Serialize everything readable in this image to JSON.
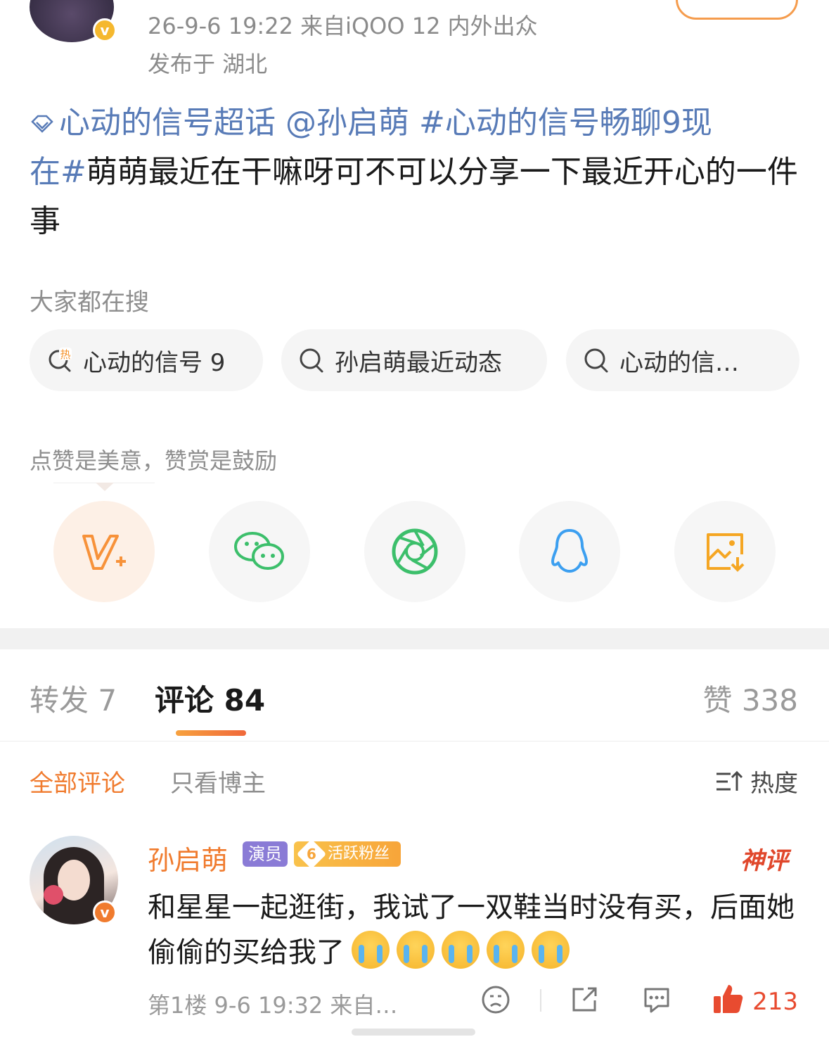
{
  "post_header": {
    "meta_line1": "26-9-6 19:22  来自iQOO 12 内外出众",
    "meta_line2": "发布于 湖北",
    "verify_mark": "v"
  },
  "post": {
    "supertopic": "心动的信号超话",
    "mention": "@孙启萌",
    "hashtag_part1": "#心动的信号畅聊9现",
    "hashtag_part2": "在#",
    "body": "萌萌最近在干嘛呀可不可以分享一下最近开心的一件事"
  },
  "hot_search": {
    "label": "大家都在搜",
    "items": [
      {
        "text": "心动的信号 9",
        "icon": "hot-search-icon"
      },
      {
        "text": "孙启萌最近动态",
        "icon": "search-icon"
      },
      {
        "text": "心动的信…",
        "icon": "search-icon"
      }
    ]
  },
  "share": {
    "hint": "点赞是美意，赞赏是鼓励",
    "buttons": [
      {
        "name": "reward",
        "icon": "v-plus-icon",
        "color": "#f7923a"
      },
      {
        "name": "wechat",
        "icon": "wechat-icon",
        "color": "#3cbf6b"
      },
      {
        "name": "moments",
        "icon": "moments-icon",
        "color": "#3cbf6b"
      },
      {
        "name": "qq",
        "icon": "qq-icon",
        "color": "#3c9ff0"
      },
      {
        "name": "save-image",
        "icon": "save-image-icon",
        "color": "#f5a623"
      }
    ]
  },
  "tabs": {
    "repost": "转发 7",
    "comments": "评论 84",
    "likes": "赞 338"
  },
  "filters": {
    "all": "全部评论",
    "owner_only": "只看博主",
    "sort": "热度"
  },
  "comment": {
    "author": "孙启萌",
    "role_badge": "演员",
    "fan_level": "6",
    "fan_badge": "活跃粉丝",
    "god_tag": "神评",
    "text": "和星星一起逛街，我试了一双鞋当时没有买，后面她偷偷的买给我了",
    "emoji_count": 5,
    "meta": "第1楼 9-6 19:32 来自…",
    "like_count": "213",
    "verify_mark": "v"
  },
  "colors": {
    "accent": "#f07b2e",
    "link": "#587bb7",
    "like": "#e84b30"
  }
}
